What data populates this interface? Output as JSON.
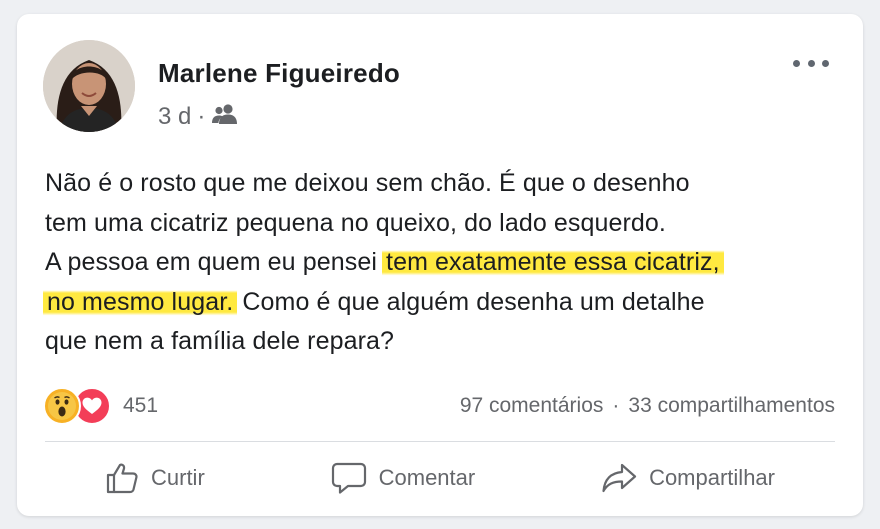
{
  "post": {
    "author": "Marlene Figueiredo",
    "time": "3 d",
    "separator": "·",
    "audience_icon": "friends-icon",
    "lines": [
      {
        "pre": "Não é o rosto que me deixou sem chão. É que o desenho",
        "hl": "",
        "post": ""
      },
      {
        "pre": "tem uma cicatriz pequena no queixo, do lado esquerdo.",
        "hl": "",
        "post": ""
      },
      {
        "pre": "A pessoa em quem eu pensei ",
        "hl": "tem exatamente essa cicatriz,",
        "post": ""
      },
      {
        "pre": "",
        "hl": "no mesmo lugar.",
        "post": " Como é que alguém desenha um detalhe"
      },
      {
        "pre": "que nem a família dele repara?",
        "hl": "",
        "post": ""
      }
    ],
    "highlight_color": "#ffe730"
  },
  "reactions": {
    "icons": [
      "wow-reaction-icon",
      "love-reaction-icon"
    ],
    "count": "451"
  },
  "stats": {
    "comments": "97 comentários",
    "separator": "·",
    "shares": "33 compartilhamentos"
  },
  "actions": {
    "like": "Curtir",
    "comment": "Comentar",
    "share": "Compartilhar"
  }
}
